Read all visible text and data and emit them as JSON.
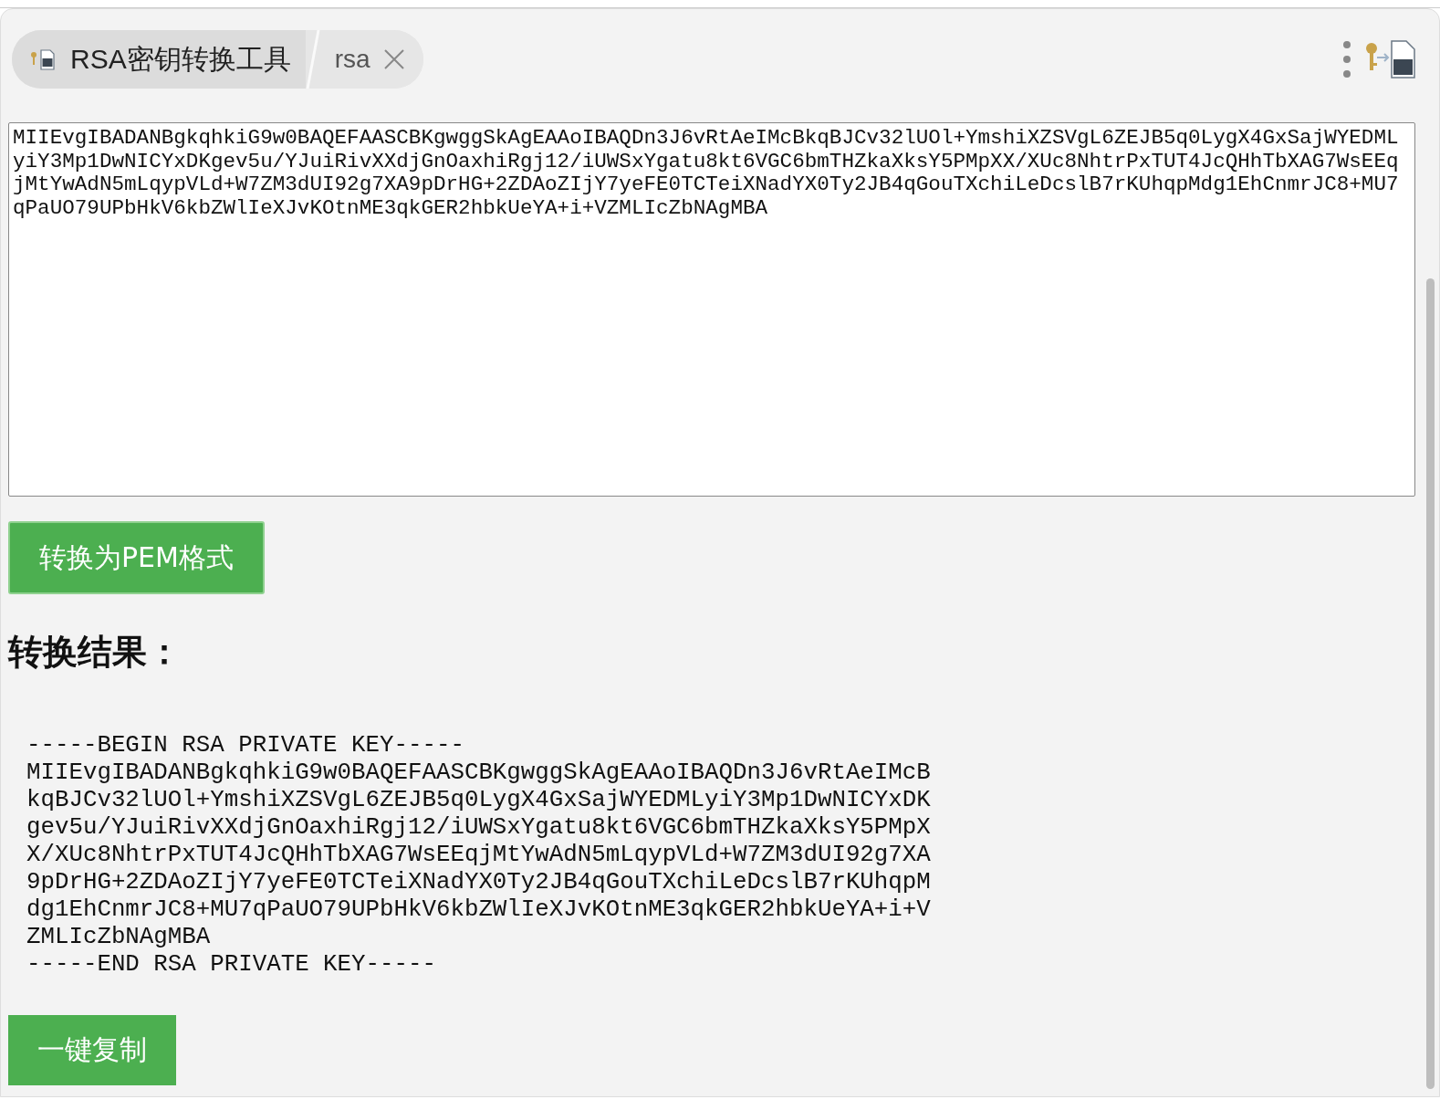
{
  "tabs": [
    {
      "label": "RSA密钥转换工具",
      "selected": true
    },
    {
      "label": "rsa",
      "selected": false,
      "closable": true
    }
  ],
  "input": {
    "value": "MIIEvgIBADANBgkqhkiG9w0BAQEFAASCBKgwggSkAgEAAoIBAQDn3J6vRtAeIMcBkqBJCv32lUOl+YmshiXZSVgL6ZEJB5q0LygX4GxSajWYEDMLyiY3Mp1DwNICYxDKgev5u/YJuiRivXXdjGnOaxhiRgj12/iUWSxYgatu8kt6VGC6bmTHZkaXksY5PMpXX/XUc8NhtrPxTUT4JcQHhTbXAG7WsEEqjMtYwAdN5mLqypVLd+W7ZM3dUI92g7XA9pDrHG+2ZDAoZIjY7yeFE0TCTeiXNadYX0Ty2JB4qGouTXchiLeDcslB7rKUhqpMdg1EhCnmrJC8+MU7qPaUO79UPbHkV6kbZWlIeXJvKOtnME3qkGER2hbkUeYA+i+VZMLIcZbNAgMBA"
  },
  "convert_button": "转换为PEM格式",
  "result_heading": "转换结果：",
  "result": "-----BEGIN RSA PRIVATE KEY-----\nMIIEvgIBADANBgkqhkiG9w0BAQEFAASCBKgwggSkAgEAAoIBAQDn3J6vRtAeIMcB\nkqBJCv32lUOl+YmshiXZSVgL6ZEJB5q0LygX4GxSajWYEDMLyiY3Mp1DwNICYxDK\ngev5u/YJuiRivXXdjGnOaxhiRgj12/iUWSxYgatu8kt6VGC6bmTHZkaXksY5PMpX\nX/XUc8NhtrPxTUT4JcQHhTbXAG7WsEEqjMtYwAdN5mLqypVLd+W7ZM3dUI92g7XA\n9pDrHG+2ZDAoZIjY7yeFE0TCTeiXNadYX0Ty2JB4qGouTXchiLeDcslB7rKUhqpM\ndg1EhCnmrJC8+MU7qPaUO79UPbHkV6kbZWlIeXJvKOtnME3qkGER2hbkUeYA+i+V\nZMLIcZbNAgMBA\n-----END RSA PRIVATE KEY-----",
  "copy_button": "一键复制"
}
